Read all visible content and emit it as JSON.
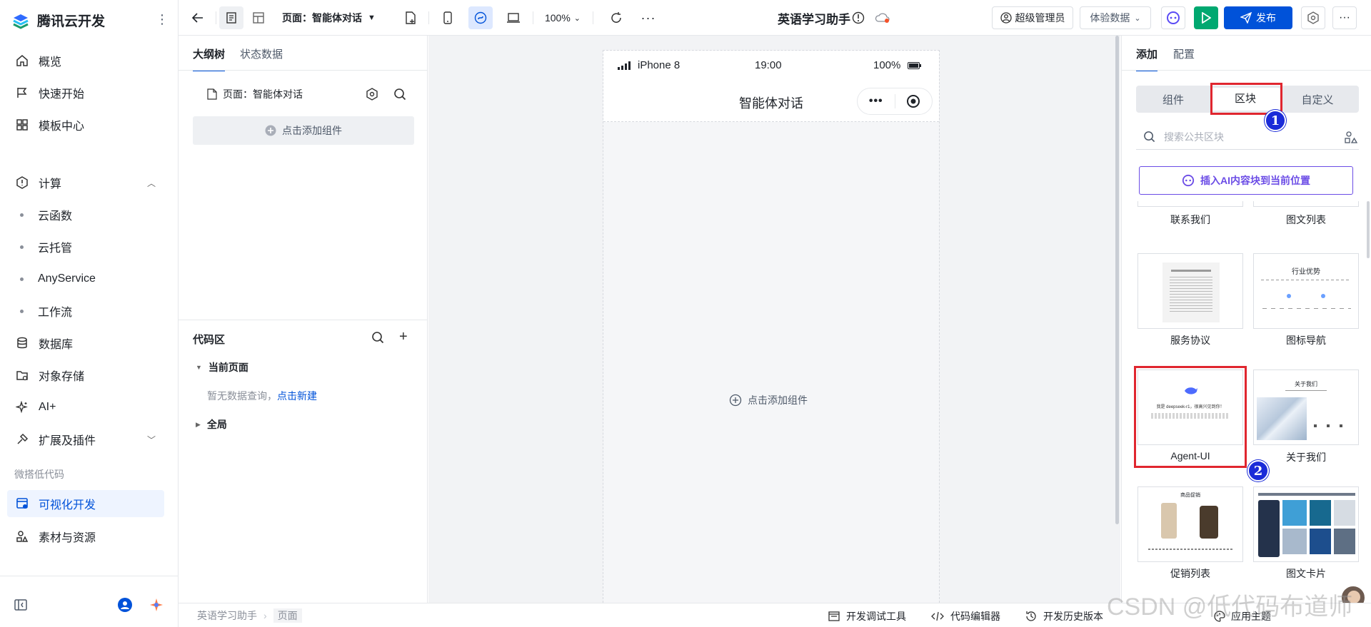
{
  "app": {
    "name": "腾讯云开发"
  },
  "nav": {
    "items": [
      {
        "label": "概览",
        "icon": "home-icon"
      },
      {
        "label": "快速开始",
        "icon": "flag-icon"
      },
      {
        "label": "模板中心",
        "icon": "grid-icon"
      },
      {
        "label": "计算",
        "icon": "cpu-icon"
      },
      {
        "label": "云函数"
      },
      {
        "label": "云托管"
      },
      {
        "label": "AnyService"
      },
      {
        "label": "工作流"
      },
      {
        "label": "数据库",
        "icon": "database-icon"
      },
      {
        "label": "对象存储",
        "icon": "folder-icon"
      },
      {
        "label": "AI+",
        "icon": "sparkle-icon"
      },
      {
        "label": "扩展及插件",
        "icon": "plugin-icon"
      }
    ],
    "section_label": "微搭低代码",
    "active_item": "可视化开发",
    "assets_item": "素材与资源"
  },
  "toolbar": {
    "page_selector": "页面：智能体对话",
    "zoom": "100%",
    "app_title": "英语学习助手",
    "role": "超级管理员",
    "data_env": "体验数据",
    "publish": "发布"
  },
  "outline": {
    "tabs": [
      "大纲树",
      "状态数据"
    ],
    "page_node": "页面：智能体对话",
    "add_component": "点击添加组件",
    "code_title": "代码区",
    "current_page": "当前页面",
    "no_query": "暂无数据查询，",
    "new_link": "点击新建",
    "global": "全局"
  },
  "phone": {
    "carrier": "iPhone 8",
    "time": "19:00",
    "battery": "100%",
    "page_title": "智能体对话",
    "add_component": "点击添加组件"
  },
  "right": {
    "tabs": [
      "添加",
      "配置"
    ],
    "seg": [
      "组件",
      "区块",
      "自定义"
    ],
    "search_placeholder": "搜索公共区块",
    "ai_insert": "插入AI内容块到当前位置",
    "blocks": [
      "联系我们",
      "图文列表",
      "服务协议",
      "图标导航",
      "Agent-UI",
      "关于我们",
      "促销列表",
      "图文卡片"
    ],
    "card_text": {
      "icon_nav_title": "行业优势",
      "agent_title": "我是 deepseek-r1，很高兴见到你！",
      "about_title": "关于我们",
      "promo_title": "商品促销"
    },
    "badges": [
      "1",
      "2"
    ]
  },
  "statusbar": {
    "breadcrumb": [
      "英语学习助手",
      "页面"
    ],
    "debug_tools": "开发调试工具",
    "code_editor": "代码编辑器",
    "history": "开发历史版本",
    "theme": "应用主题"
  },
  "watermark": "CSDN @低代码布道师",
  "colors": {
    "brand": "#0052d9",
    "publish": "#0052d9",
    "run": "#00a870",
    "highlight": "#e0262f",
    "badge": "#1a2bd8"
  }
}
